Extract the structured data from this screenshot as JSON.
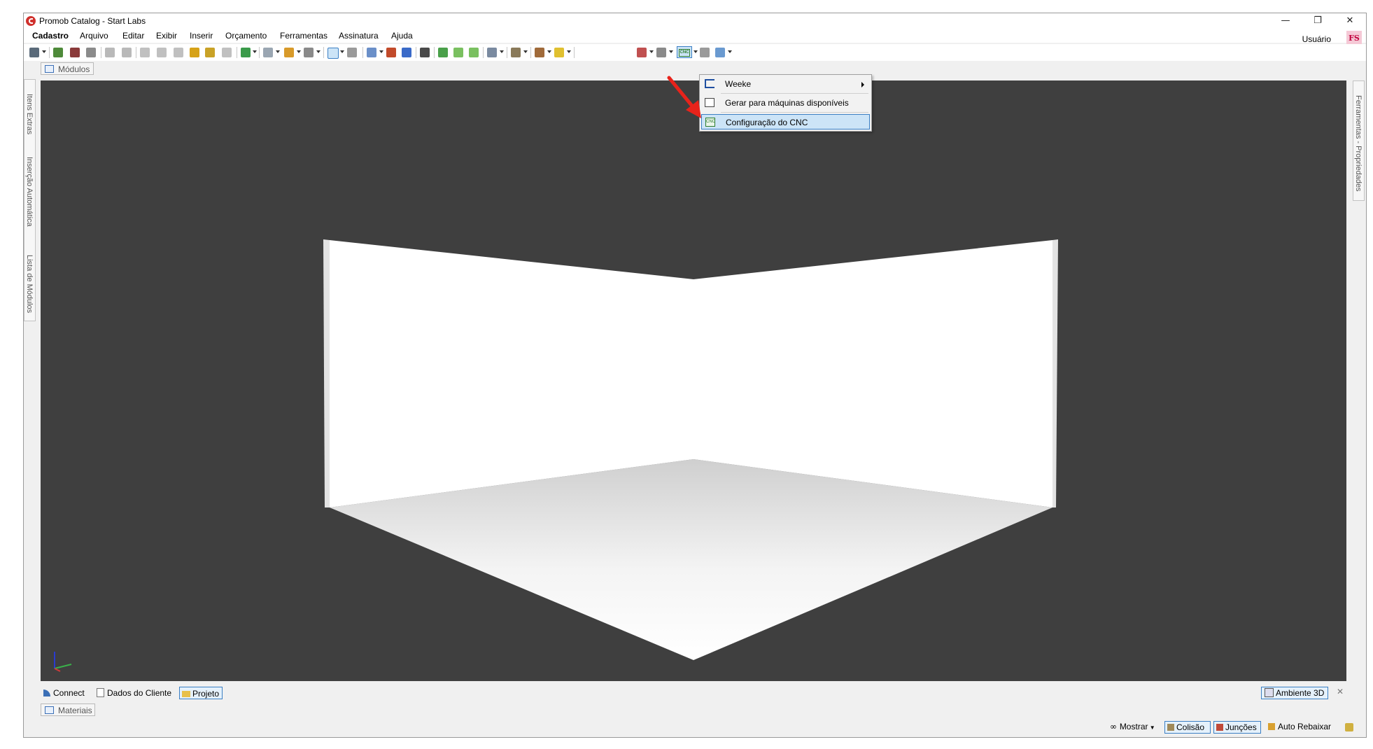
{
  "window": {
    "title": "Promob Catalog - Start Labs",
    "controls": {
      "minimize": "—",
      "restore": "❐",
      "close": "✕"
    }
  },
  "menu": {
    "items": [
      "Cadastro",
      "Arquivo",
      "Editar",
      "Exibir",
      "Inserir",
      "Orçamento",
      "Ferramentas",
      "Assinatura",
      "Ajuda"
    ],
    "user_label": "Usuário",
    "user_initials": "FS"
  },
  "panels": {
    "modules_tab": "Módulos",
    "left_side_tabs": [
      "Itens Extras",
      "Inserção Automática",
      "Lista de Módulos"
    ],
    "right_side_tab": "Ferramentas - Propriedades",
    "materials_tab": "Materiais"
  },
  "dropdown": {
    "items": [
      {
        "label": "Weeke",
        "has_submenu": true
      },
      {
        "label": "Gerar para máquinas disponíveis",
        "has_submenu": false
      },
      {
        "label": "Configuração do CNC",
        "has_submenu": false,
        "highlighted": true
      }
    ]
  },
  "toolbar": {
    "cnc_button_label": "CNC"
  },
  "bottom_tabs": {
    "items": [
      "Connect",
      "Dados do Cliente",
      "Projeto"
    ],
    "active": "Projeto",
    "ambiente_button": "Ambiente 3D",
    "close": "✕"
  },
  "statusbar": {
    "items": [
      "Mostrar",
      "Colisão",
      "Junções",
      "Auto Rebaixar"
    ]
  },
  "colors": {
    "viewport_bg": "#3f3f3f",
    "highlight": "#cce4f7",
    "highlight_border": "#3b7fc4",
    "annotation_arrow": "#e8231b"
  }
}
